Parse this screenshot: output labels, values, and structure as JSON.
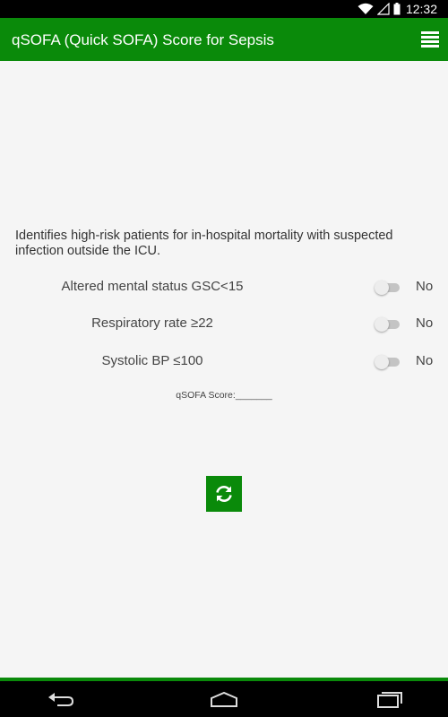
{
  "status_bar": {
    "time": "12:32",
    "icons": [
      "wifi-icon",
      "signal-icon",
      "battery-icon"
    ]
  },
  "app_bar": {
    "title": "qSOFA (Quick SOFA) Score for Sepsis",
    "menu_icon": "menu-icon"
  },
  "description": "Identifies high-risk patients for in-hospital mortality with suspected infection outside the ICU.",
  "criteria": [
    {
      "label": "Altered mental status GSC<15",
      "value": "No"
    },
    {
      "label": "Respiratory rate ≥22",
      "value": "No"
    },
    {
      "label": "Systolic BP ≤100",
      "value": "No"
    }
  ],
  "score": {
    "text": "qSOFA Score:_______"
  },
  "refresh_button": {
    "icon": "refresh-icon"
  },
  "nav_bar": {
    "buttons": [
      "back-icon",
      "home-icon",
      "recents-icon"
    ]
  },
  "colors": {
    "primary": "#0a8a0a",
    "background": "#f5f5f5",
    "text": "#444444"
  }
}
